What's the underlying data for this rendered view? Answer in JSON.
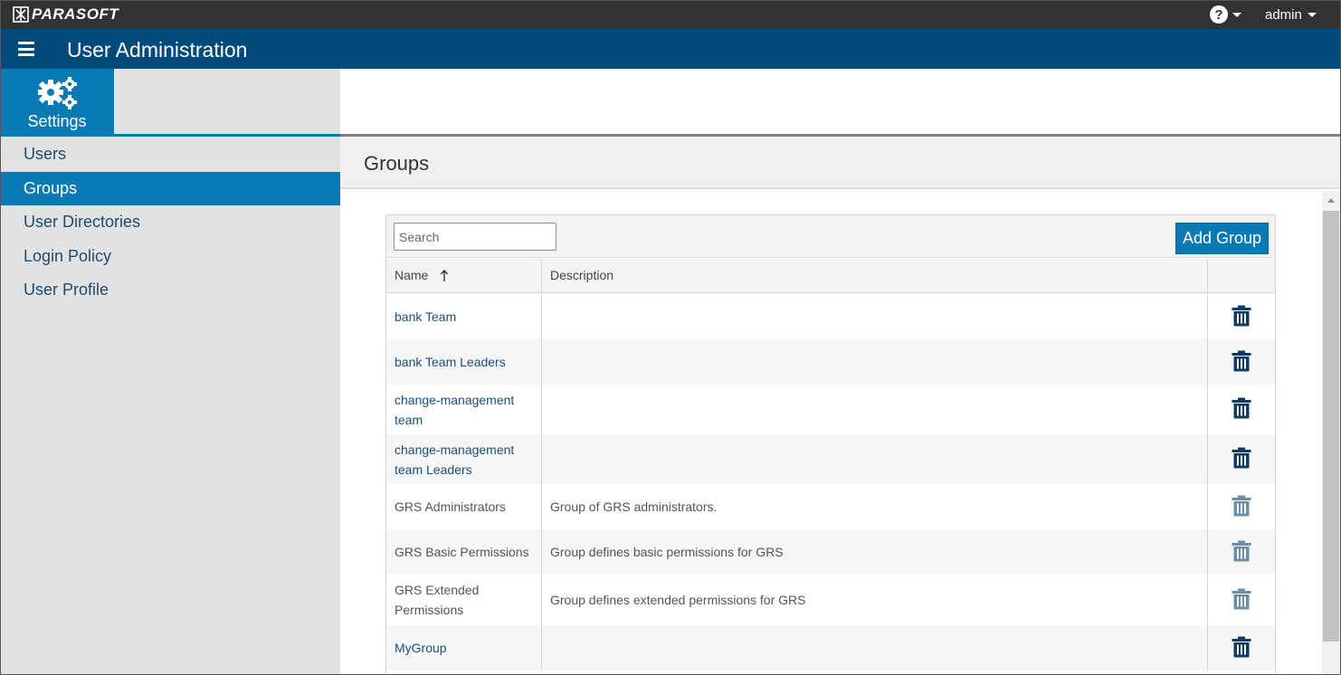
{
  "app": {
    "brand": "PARASOFT",
    "title": "User Administration",
    "user": "admin",
    "help_symbol": "?"
  },
  "colors": {
    "topbar": "#323232",
    "titlebar": "#004a7c",
    "accent": "#0a7ab5",
    "link": "#1a4f7d",
    "trash_active": "#0d3c66",
    "trash_disabled": "#6f8fa8"
  },
  "sidebar": {
    "tile_label": "Settings",
    "tile_icon": "gears-icon",
    "items": [
      {
        "label": "Users",
        "active": false
      },
      {
        "label": "Groups",
        "active": true
      },
      {
        "label": "User Directories",
        "active": false
      },
      {
        "label": "Login Policy",
        "active": false
      },
      {
        "label": "User Profile",
        "active": false
      }
    ]
  },
  "main": {
    "section_title": "Groups",
    "search": {
      "placeholder": "Search",
      "value": ""
    },
    "add_button": "Add Group",
    "columns": {
      "name": "Name",
      "description": "Description",
      "actions": ""
    },
    "sort": {
      "column": "name",
      "direction": "ascending"
    },
    "rows": [
      {
        "name": "bank Team",
        "description": "",
        "editable": true
      },
      {
        "name": "bank Team Leaders",
        "description": "",
        "editable": true
      },
      {
        "name": "change-management team",
        "description": "",
        "editable": true
      },
      {
        "name": "change-management team Leaders",
        "description": "",
        "editable": true
      },
      {
        "name": "GRS Administrators",
        "description": "Group of GRS administrators.",
        "editable": false
      },
      {
        "name": "GRS Basic Permissions",
        "description": "Group defines basic permissions for GRS",
        "editable": false
      },
      {
        "name": "GRS Extended Permissions",
        "description": "Group defines extended permissions for GRS",
        "editable": false
      },
      {
        "name": "MyGroup",
        "description": "",
        "editable": true
      }
    ]
  }
}
